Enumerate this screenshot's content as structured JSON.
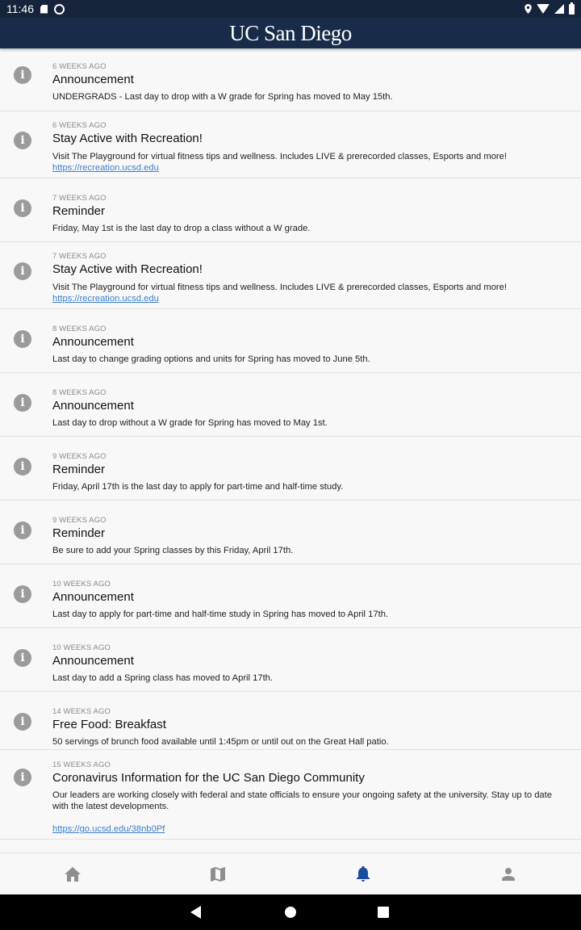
{
  "status_bar": {
    "time": "11:46",
    "icons": [
      "sd-card-icon",
      "sync-icon",
      "location-icon",
      "wifi-icon",
      "signal-icon",
      "battery-icon"
    ]
  },
  "header": {
    "brand": "UC San Diego",
    "background": "#182b49"
  },
  "notifications": [
    {
      "when": "6 WEEKS AGO",
      "title": "Announcement",
      "message": "UNDERGRADS - Last day to drop with a W grade for Spring has moved to May 15th."
    },
    {
      "when": "6 WEEKS AGO",
      "title": "Stay Active with Recreation!",
      "message": "Visit The Playground for virtual fitness tips and wellness. Includes LIVE & prerecorded classes, Esports and more!",
      "link": "https://recreation.ucsd.edu"
    },
    {
      "when": "7 WEEKS AGO",
      "title": "Reminder",
      "message": "Friday, May 1st is the last day to drop a class without a W grade."
    },
    {
      "when": "7 WEEKS AGO",
      "title": "Stay Active with Recreation!",
      "message": "Visit The Playground for virtual fitness tips and wellness. Includes LIVE & prerecorded classes, Esports and more!",
      "link": "https://recreation.ucsd.edu"
    },
    {
      "when": "8 WEEKS AGO",
      "title": "Announcement",
      "message": "Last day to change grading options and units for Spring has moved to June 5th."
    },
    {
      "when": "8 WEEKS AGO",
      "title": "Announcement",
      "message": "Last day to drop without a W grade for Spring has moved to May 1st."
    },
    {
      "when": "9 WEEKS AGO",
      "title": "Reminder",
      "message": "Friday, April 17th is the last day to apply for part-time and half-time study."
    },
    {
      "when": "9 WEEKS AGO",
      "title": "Reminder",
      "message": "Be sure to add your Spring classes by this Friday, April 17th."
    },
    {
      "when": "10 WEEKS AGO",
      "title": "Announcement",
      "message": "Last day to apply for part-time and half-time study in Spring has moved to April 17th."
    },
    {
      "when": "10 WEEKS AGO",
      "title": "Announcement",
      "message": "Last day to add a Spring class has moved to April 17th."
    },
    {
      "when": "14 WEEKS AGO",
      "title": "Free Food: Breakfast",
      "message": "50 servings of brunch food available until 1:45pm or until out on the Great Hall patio."
    },
    {
      "when": "15 WEEKS AGO",
      "title": "Coronavirus Information for the UC San Diego Community",
      "message": "Our leaders are working closely with federal and state officials to ensure your ongoing safety at the university. Stay up to date with the latest developments.",
      "link": "https://go.ucsd.edu/38nb0Pf"
    }
  ],
  "bottom_nav": {
    "tabs": [
      {
        "name": "home",
        "icon": "home-icon",
        "active": false
      },
      {
        "name": "map",
        "icon": "map-icon",
        "active": false
      },
      {
        "name": "notifications",
        "icon": "bell-icon",
        "active": true
      },
      {
        "name": "profile",
        "icon": "person-icon",
        "active": false
      }
    ],
    "active_color": "#1b4ea0",
    "inactive_color": "#8e8e8e"
  },
  "android_nav": {
    "buttons": [
      "back-icon",
      "home-circle-icon",
      "recents-icon"
    ]
  }
}
